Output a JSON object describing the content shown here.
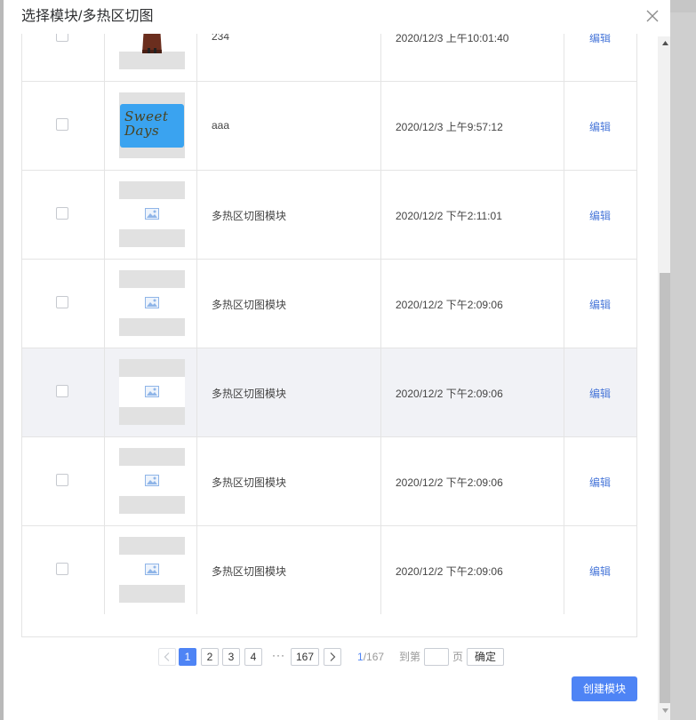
{
  "dialog": {
    "title": "选择模块/多热区切图",
    "close_icon": "close-icon"
  },
  "table": {
    "rows": [
      {
        "name": "234",
        "time": "2020/12/3 上午10:01:40",
        "action": "编辑",
        "thumb": "dress-photo"
      },
      {
        "name": "aaa",
        "time": "2020/12/3 上午9:57:12",
        "action": "编辑",
        "thumb": "sweet-days-image",
        "thumb_text": "Sweet Days"
      },
      {
        "name": "多热区切图模块",
        "time": "2020/12/2 下午2:11:01",
        "action": "编辑",
        "thumb": "image-placeholder-icon"
      },
      {
        "name": "多热区切图模块",
        "time": "2020/12/2 下午2:09:06",
        "action": "编辑",
        "thumb": "image-placeholder-icon"
      },
      {
        "name": "多热区切图模块",
        "time": "2020/12/2 下午2:09:06",
        "action": "编辑",
        "thumb": "image-placeholder-icon",
        "hovered": true
      },
      {
        "name": "多热区切图模块",
        "time": "2020/12/2 下午2:09:06",
        "action": "编辑",
        "thumb": "image-placeholder-icon"
      },
      {
        "name": "多热区切图模块",
        "time": "2020/12/2 下午2:09:06",
        "action": "编辑",
        "thumb": "image-placeholder-icon"
      }
    ]
  },
  "pagination": {
    "pages": [
      "1",
      "2",
      "3",
      "4"
    ],
    "current_page": "1",
    "ellipsis": "···",
    "last_page": "167",
    "current": "1",
    "total": "/167",
    "goto_prefix": "到第",
    "goto_suffix": "页",
    "goto_value": "",
    "confirm_label": "确定"
  },
  "footer": {
    "create_label": "创建模块"
  },
  "colors": {
    "accent": "#4e84f5",
    "link": "#4a78d9",
    "hover_row": "#f1f2f6",
    "border": "#e4e4e4"
  }
}
